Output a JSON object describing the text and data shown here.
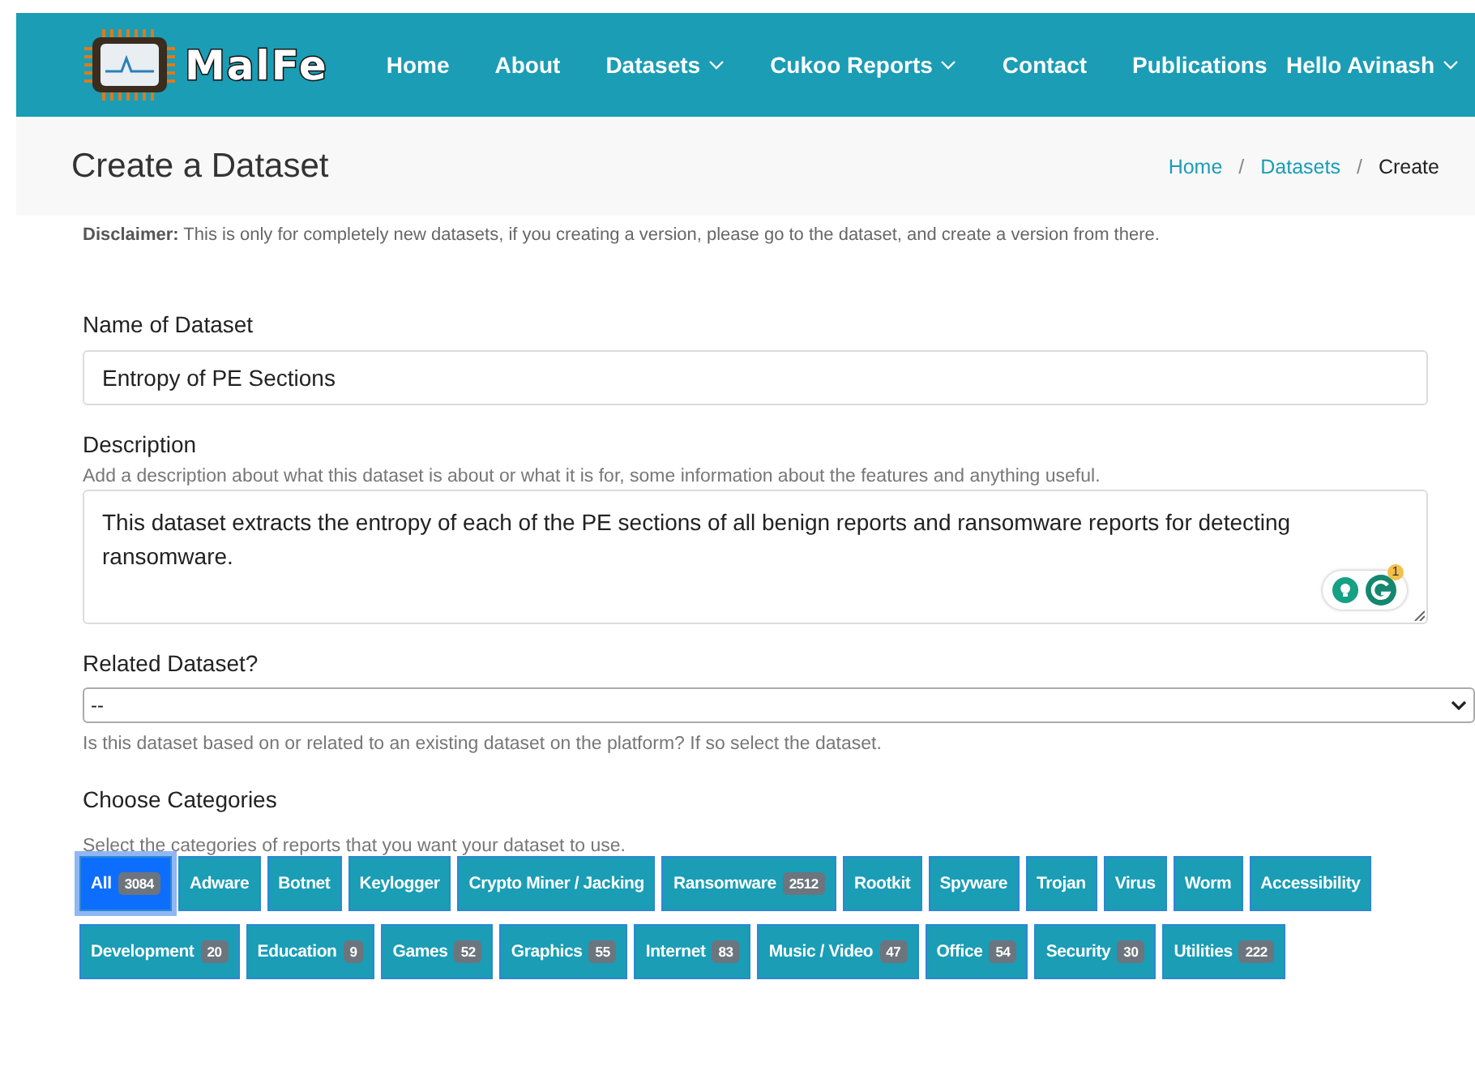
{
  "navbar": {
    "brand": "MalFe",
    "links": [
      {
        "label": "Home",
        "dropdown": false
      },
      {
        "label": "About",
        "dropdown": false
      },
      {
        "label": "Datasets",
        "dropdown": true
      },
      {
        "label": "Cukoo Reports",
        "dropdown": true
      },
      {
        "label": "Contact",
        "dropdown": false
      },
      {
        "label": "Publications",
        "dropdown": false
      }
    ],
    "user": {
      "label": "Hello Avinash",
      "dropdown": true
    }
  },
  "header": {
    "title": "Create a Dataset",
    "separator": "/",
    "breadcrumb": [
      {
        "label": "Home",
        "current": false
      },
      {
        "label": "Datasets",
        "current": false
      },
      {
        "label": "Create",
        "current": true
      }
    ]
  },
  "disclaimer": "**Disclaimer:** This is only for completely new datasets, if you creating a version, please go to the dataset, and create a version from there.",
  "form": {
    "name": {
      "label": "Name of Dataset",
      "value": "Entropy of PE Sections"
    },
    "description": {
      "label": "Description",
      "help": "Add a description about what this dataset is about or what it is for, some information about the features and anything useful.",
      "value": "This dataset extracts the entropy of each of the PE sections of all benign reports and ransomware reports for detecting ransomware.",
      "assistant_badge": "1"
    },
    "related": {
      "label": "Related Dataset?",
      "value": "--",
      "help": "Is this dataset based on or related to an existing dataset on the platform? If so select the dataset."
    },
    "categories": {
      "label": "Choose Categories",
      "help": "Select the categories of reports that you want your dataset to use.",
      "items": [
        {
          "label": "All",
          "count": "3084",
          "selected": true
        },
        {
          "label": "Adware",
          "selected": false
        },
        {
          "label": "Botnet",
          "selected": false
        },
        {
          "label": "Keylogger",
          "selected": false
        },
        {
          "label": "Crypto Miner / Jacking",
          "selected": false
        },
        {
          "label": "Ransomware",
          "count": "2512",
          "selected": false
        },
        {
          "label": "Rootkit",
          "selected": false
        },
        {
          "label": "Spyware",
          "selected": false
        },
        {
          "label": "Trojan",
          "selected": false
        },
        {
          "label": "Virus",
          "selected": false
        },
        {
          "label": "Worm",
          "selected": false
        },
        {
          "label": "Accessibility",
          "selected": false
        },
        {
          "label": "Development",
          "count": "20",
          "selected": false
        },
        {
          "label": "Education",
          "count": "9",
          "selected": false
        },
        {
          "label": "Games",
          "count": "52",
          "selected": false
        },
        {
          "label": "Graphics",
          "count": "55",
          "selected": false
        },
        {
          "label": "Internet",
          "count": "83",
          "selected": false
        },
        {
          "label": "Music / Video",
          "count": "47",
          "selected": false
        },
        {
          "label": "Office",
          "count": "54",
          "selected": false
        },
        {
          "label": "Security",
          "count": "30",
          "selected": false
        },
        {
          "label": "Utilities",
          "count": "222",
          "selected": false
        }
      ]
    }
  }
}
